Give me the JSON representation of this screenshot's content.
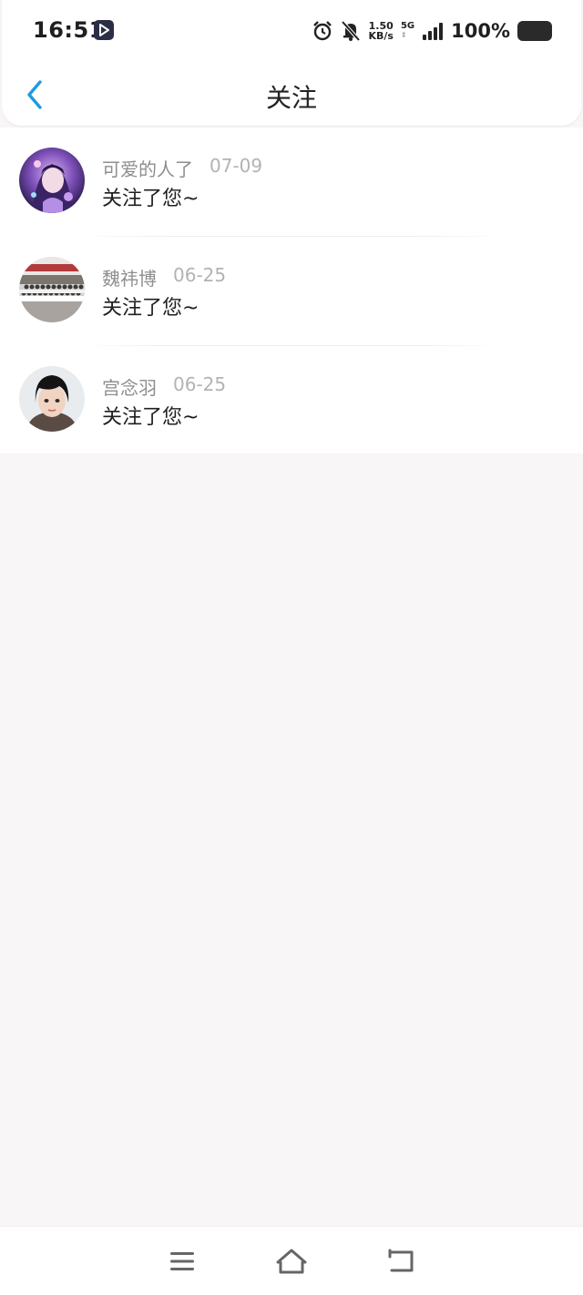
{
  "status_bar": {
    "time": "16:51",
    "net_speed_value": "1.50",
    "net_speed_unit": "KB/s",
    "network_type": "5G",
    "battery_text": "100%",
    "icons": [
      "app-notification-icon",
      "alarm-icon",
      "mute-icon",
      "signal-icon",
      "battery-icon"
    ]
  },
  "header": {
    "title": "关注",
    "back_icon": "chevron-left-icon",
    "accent_color": "#1e9be0"
  },
  "items": [
    {
      "name": "可爱的人了",
      "date": "07-09",
      "message": "关注了您~",
      "avatar": "avatar-anime"
    },
    {
      "name": "魏祎博",
      "date": "06-25",
      "message": "关注了您~",
      "avatar": "avatar-group"
    },
    {
      "name": "宫念羽",
      "date": "06-25",
      "message": "关注了您~",
      "avatar": "avatar-portrait"
    }
  ],
  "nav": {
    "icons": [
      "menu-icon",
      "home-icon",
      "back-icon"
    ]
  }
}
